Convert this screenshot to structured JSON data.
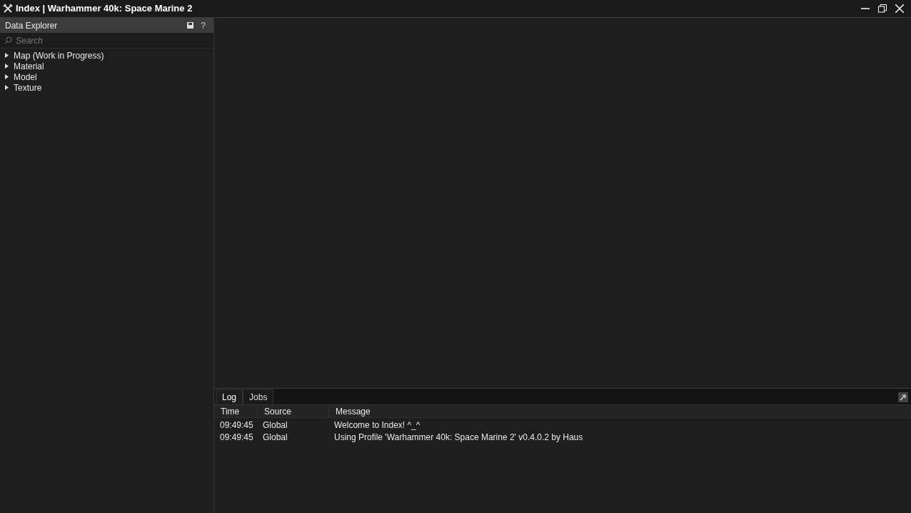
{
  "window": {
    "title": "Index | Warhammer 40k: Space Marine 2"
  },
  "sidebar": {
    "title": "Data Explorer",
    "help": "?",
    "search": {
      "placeholder": "Search"
    },
    "items": [
      {
        "label": "Map (Work in Progress)",
        "expanded": false
      },
      {
        "label": "Material",
        "expanded": false
      },
      {
        "label": "Model",
        "expanded": false
      },
      {
        "label": "Texture",
        "expanded": false
      }
    ]
  },
  "bottom_panel": {
    "tabs": [
      {
        "label": "Log",
        "selected": true
      },
      {
        "label": "Jobs",
        "selected": false
      }
    ],
    "columns": [
      "Time",
      "Source",
      "Message"
    ],
    "rows": [
      [
        "09:49:45",
        "Global",
        "Welcome to Index! ^_^"
      ],
      [
        "09:49:45",
        "Global",
        "Using Profile 'Warhammer 40k: Space Marine 2' v0.4.0.2 by Haus"
      ]
    ]
  }
}
